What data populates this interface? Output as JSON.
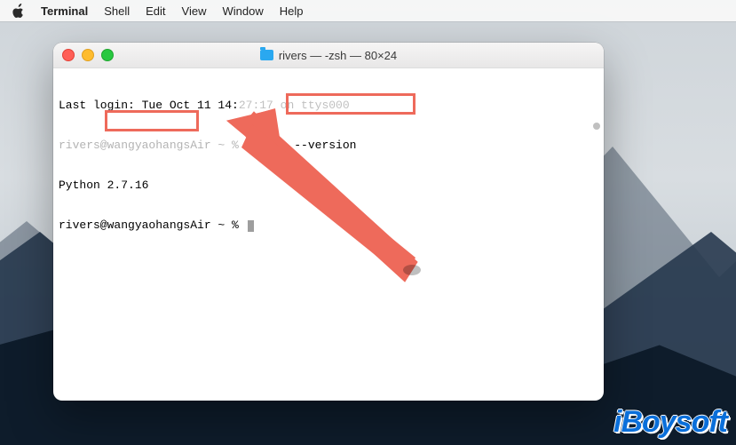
{
  "menubar": {
    "app": "Terminal",
    "items": [
      "Shell",
      "Edit",
      "View",
      "Window",
      "Help"
    ]
  },
  "window": {
    "title": "rivers — -zsh — 80×24"
  },
  "terminal": {
    "line1_prefix": "Last login: Tue Oct 11 14:",
    "line1_obscured": "27:17 on ttys000",
    "line2_prompt_prefix": "rivers@wangyaohangsAir ~ % ",
    "line2_command": "Python --version",
    "line3_output": "Python 2.7.16",
    "line4_prompt": "rivers@wangyaohangsAir ~ % "
  },
  "annotations": {
    "highlight_command": "Python --version",
    "highlight_output": "Python 2.7.16"
  },
  "watermark": "iBoysoft"
}
